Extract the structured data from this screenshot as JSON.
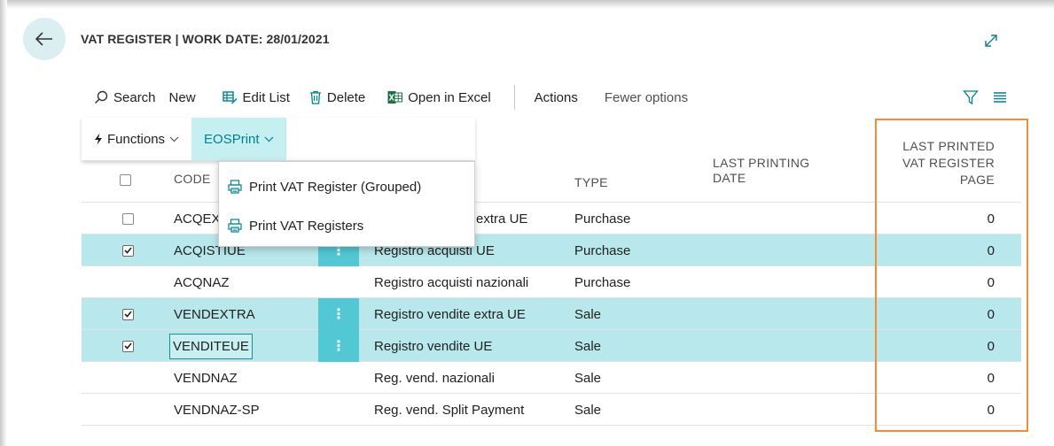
{
  "header": {
    "title": "VAT REGISTER | WORK DATE: 28/01/2021"
  },
  "actions": {
    "search": "Search",
    "new": "New",
    "edit_list": "Edit List",
    "delete": "Delete",
    "open_in_excel": "Open in Excel",
    "actions": "Actions",
    "fewer_options": "Fewer options"
  },
  "subbar": {
    "functions": "Functions",
    "eosprint": "EOSPrint"
  },
  "menu": {
    "items": [
      "Print VAT Register (Grouped)",
      "Print VAT Registers"
    ]
  },
  "columns": {
    "code": "CODE",
    "type": "TYPE",
    "last_printing_date_1": "LAST PRINTING",
    "last_printing_date_2": "DATE",
    "last_printed_page_1": "LAST PRINTED",
    "last_printed_page_2": "VAT REGISTER",
    "last_printed_page_3": "PAGE"
  },
  "rows": [
    {
      "code": "ACQEXT",
      "description": "Registro acquisti extra UE",
      "type": "Purchase",
      "last_printing_date": "",
      "last_printed_page": "0",
      "selected": false,
      "checked": false
    },
    {
      "code": "ACQISTIUE",
      "description": "Registro acquisti UE",
      "type": "Purchase",
      "last_printing_date": "",
      "last_printed_page": "0",
      "selected": true,
      "checked": true
    },
    {
      "code": "ACQNAZ",
      "description": "Registro acquisti nazionali",
      "type": "Purchase",
      "last_printing_date": "",
      "last_printed_page": "0",
      "selected": false,
      "checked": false
    },
    {
      "code": "VENDEXTRA",
      "description": "Registro vendite extra UE",
      "type": "Sale",
      "last_printing_date": "",
      "last_printed_page": "0",
      "selected": true,
      "checked": true
    },
    {
      "code": "VENDITEUE",
      "description": "Registro vendite UE",
      "type": "Sale",
      "last_printing_date": "",
      "last_printed_page": "0",
      "selected": true,
      "checked": true
    },
    {
      "code": "VENDNAZ",
      "description": "Reg. vend. nazionali",
      "type": "Sale",
      "last_printing_date": "",
      "last_printed_page": "0",
      "selected": false,
      "checked": false
    },
    {
      "code": "VENDNAZ-SP",
      "description": "Reg. vend. Split Payment",
      "type": "Sale",
      "last_printing_date": "",
      "last_printed_page": "0",
      "selected": false,
      "checked": false
    }
  ],
  "colors": {
    "accent": "#00818f",
    "selected_row": "#b8e8ec",
    "highlight": "#f08c3a"
  },
  "icons": {
    "back": "arrow-left-icon",
    "expand": "expand-icon",
    "search": "search-icon",
    "edit_list": "edit-list-icon",
    "delete": "trash-icon",
    "excel": "excel-icon",
    "filter": "filter-icon",
    "list_view": "list-view-icon",
    "functions": "lightning-icon",
    "print": "print-icon",
    "row_actions": "vertical-dots-icon"
  }
}
